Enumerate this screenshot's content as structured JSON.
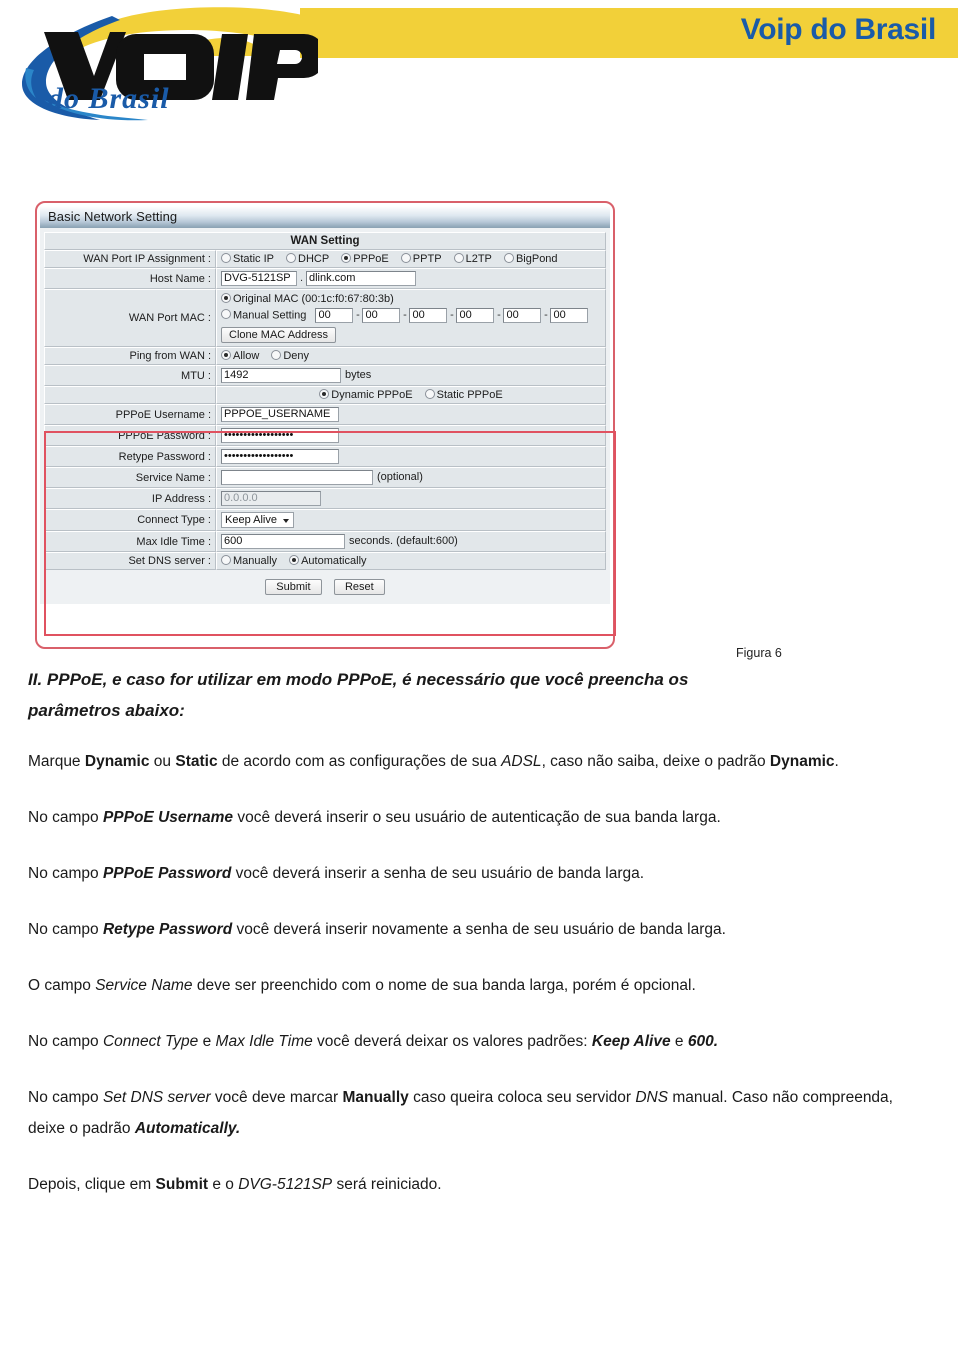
{
  "header": {
    "brand_title": "Voip do Brasil",
    "logo_main": "VOIP",
    "logo_sub": "do Brasil",
    "yellow": "#F2D039",
    "blue": "#1A5BA8"
  },
  "router": {
    "panel_title": "Basic Network Setting",
    "section_title": "WAN Setting",
    "rows": {
      "wan_ip_assignment": {
        "label": "WAN Port IP Assignment :",
        "options": [
          "Static IP",
          "DHCP",
          "PPPoE",
          "PPTP",
          "L2TP",
          "BigPond"
        ],
        "selected": "PPPoE"
      },
      "host_name": {
        "label": "Host Name :",
        "host": "DVG-5121SP",
        "separator": ".",
        "domain": "dlink.com"
      },
      "wan_port_mac": {
        "label": "WAN Port MAC :",
        "original_label": "Original MAC (00:1c:f0:67:80:3b)",
        "manual_label": "Manual Setting",
        "selected": "Original MAC",
        "manual_octets": [
          "00",
          "00",
          "00",
          "00",
          "00",
          "00"
        ],
        "clone_button": "Clone MAC Address"
      },
      "ping_from_wan": {
        "label": "Ping from WAN :",
        "options": [
          "Allow",
          "Deny"
        ],
        "selected": "Allow"
      },
      "mtu": {
        "label": "MTU :",
        "value": "1492",
        "unit": "bytes"
      },
      "pppoe_mode": {
        "options": [
          "Dynamic PPPoE",
          "Static PPPoE"
        ],
        "selected": "Dynamic PPPoE"
      },
      "pppoe_username": {
        "label": "PPPoE Username :",
        "value": "PPPOE_USERNAME"
      },
      "pppoe_password": {
        "label": "PPPoE Password :",
        "value": "••••••••••••••••••"
      },
      "retype_password": {
        "label": "Retype Password :",
        "value": "••••••••••••••••••"
      },
      "service_name": {
        "label": "Service Name :",
        "value": "",
        "note": "(optional)"
      },
      "ip_address": {
        "label": "IP Address :",
        "value": "0.0.0.0"
      },
      "connect_type": {
        "label": "Connect Type :",
        "value": "Keep Alive"
      },
      "max_idle_time": {
        "label": "Max Idle Time :",
        "value": "600",
        "unit": "seconds. (default:600)"
      },
      "set_dns_server": {
        "label": "Set DNS server :",
        "options": [
          "Manually",
          "Automatically"
        ],
        "selected": "Automatically"
      }
    },
    "submit_button": "Submit",
    "reset_button": "Reset",
    "highlight_color": "#E05260"
  },
  "figure_caption": "Figura 6",
  "content": {
    "heading_line1": "II. PPPoE,  e caso for utilizar em modo PPPoE, é necessário que você preencha os",
    "heading_line2": "parâmetros abaixo:",
    "p1": {
      "a": "Marque ",
      "b1": "Dynamic",
      "c": " ou ",
      "b2": "Static",
      "d": " de acordo com as configurações de sua ",
      "i1": "ADSL",
      "e": ", caso não saiba, deixe o padrão ",
      "b3": "Dynamic",
      "f": "."
    },
    "p2": {
      "a": "No campo ",
      "b1": "PPPoE Username",
      "c": " você deverá inserir o seu usuário de autenticação de sua banda larga."
    },
    "p3": {
      "a": "No campo ",
      "b1": "PPPoE Password",
      "c": " você deverá inserir a senha de seu usuário de banda larga."
    },
    "p4": {
      "a": "No campo ",
      "b1": "Retype Password",
      "c": " você deverá inserir novamente a senha de seu usuário de banda larga."
    },
    "p5": {
      "a": "O campo ",
      "i1": "Service Name",
      "c": " deve ser preenchido com o nome de sua banda larga, porém é opcional."
    },
    "p6": {
      "a": "No campo ",
      "i1": "Connect Type",
      "c": " e ",
      "i2": "Max Idle Time",
      "d": " você deverá deixar os valores padrões: ",
      "b1": "Keep Alive",
      "e": " e ",
      "b2": "600."
    },
    "p7": {
      "a": "No campo ",
      "i1": "Set DNS server",
      "c": " você deve marcar ",
      "b1": "Manually",
      "d": " caso queira coloca seu servidor ",
      "i2": "DNS",
      "e": " manual. Caso não compreenda, deixe o padrão ",
      "b2": "Automatically."
    },
    "p8": {
      "a": "Depois, clique em ",
      "b1": "Submit",
      "c": " e o ",
      "i1": "DVG-5121SP",
      "d": " será reiniciado."
    }
  }
}
